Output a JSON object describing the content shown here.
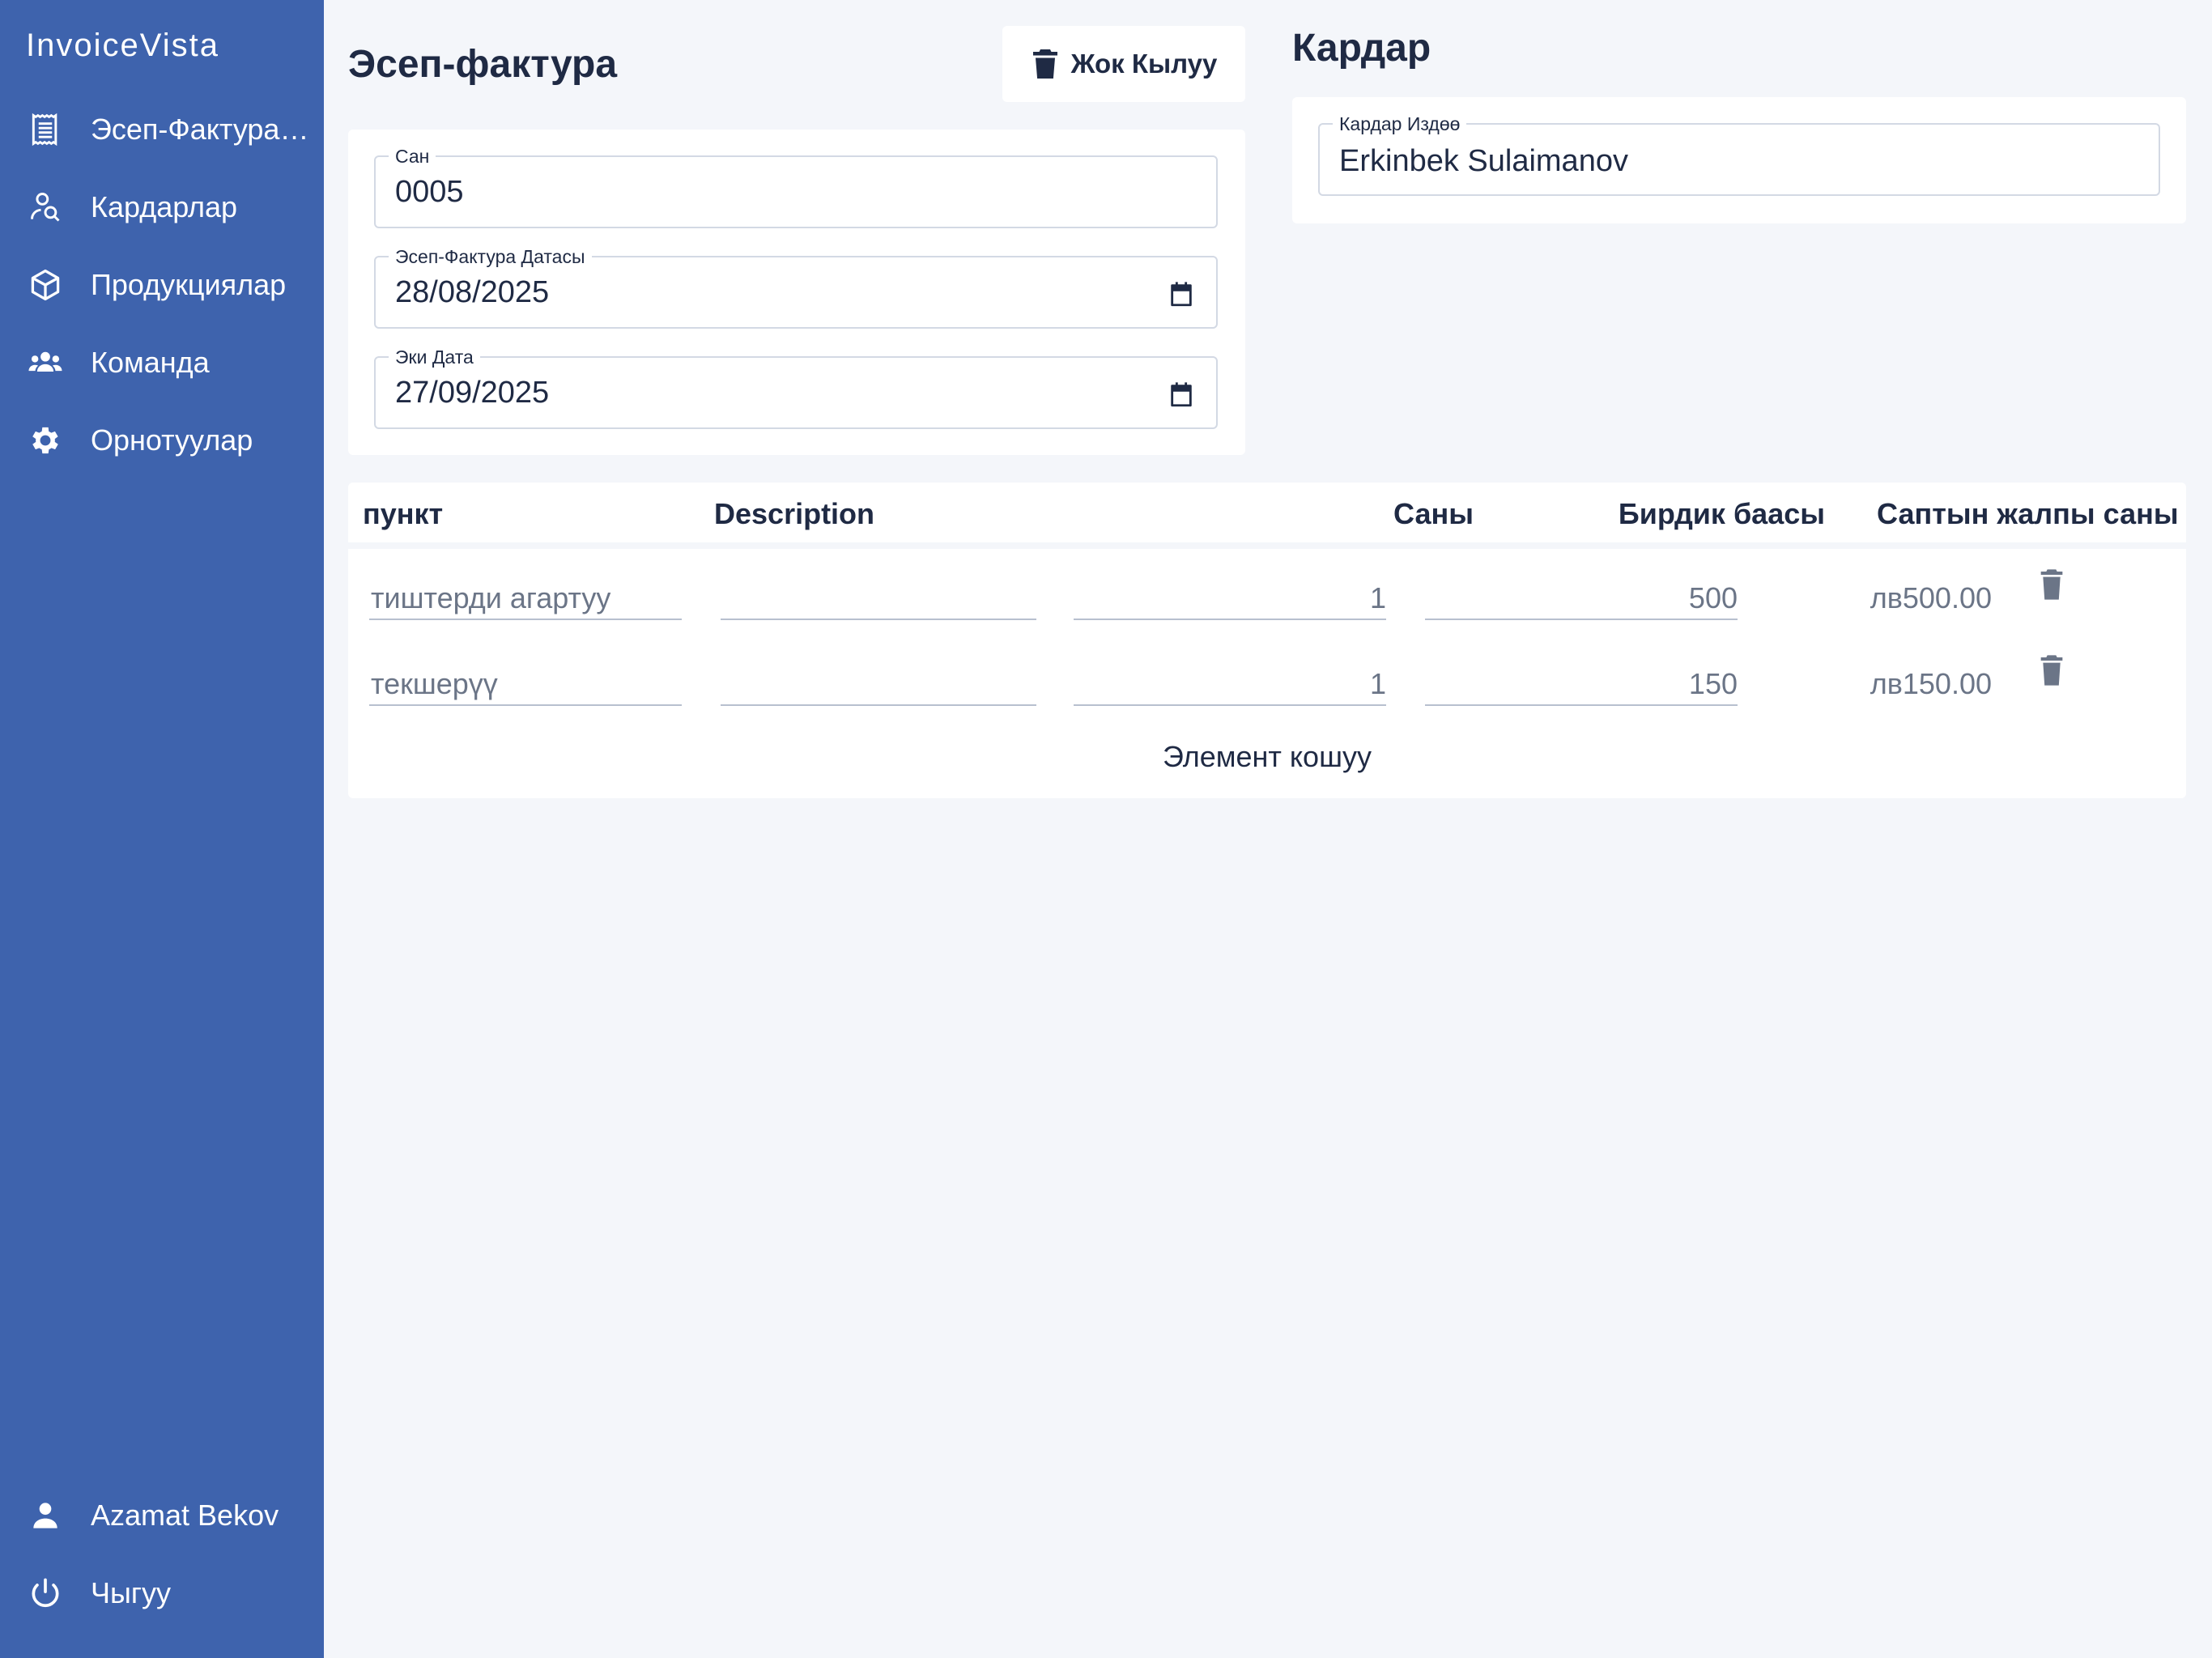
{
  "app": {
    "brand": "InvoiceVista"
  },
  "sidebar": {
    "items": [
      {
        "label": "Эсеп-Фактуралар",
        "icon": "invoice-list-icon"
      },
      {
        "label": "Кардарлар",
        "icon": "user-search-icon"
      },
      {
        "label": "Продукциялар",
        "icon": "box-icon"
      },
      {
        "label": "Команда",
        "icon": "team-icon"
      },
      {
        "label": "Орнотуулар",
        "icon": "gear-icon"
      }
    ],
    "user": {
      "label": "Azamat Bekov",
      "icon": "person-icon"
    },
    "logout": {
      "label": "Чыгуу",
      "icon": "power-icon"
    }
  },
  "invoice": {
    "title": "Эсеп-фактура",
    "delete_label": "Жок Кылуу",
    "number": {
      "label": "Сан",
      "value": "0005"
    },
    "invoice_date": {
      "label": "Эсеп-Фактура Датасы",
      "value": "28/08/2025"
    },
    "due_date": {
      "label": "Эки Дата",
      "value": "27/09/2025"
    }
  },
  "customer": {
    "title": "Кардар",
    "search": {
      "label": "Кардар Издөө",
      "value": "Erkinbek Sulaimanov"
    }
  },
  "items_table": {
    "headers": {
      "item": "пункт",
      "description": "Description",
      "quantity": "Саны",
      "unit_price": "Бирдик баасы",
      "line_total": "Саптын жалпы саны"
    },
    "rows": [
      {
        "item": "тиштерди агартуу",
        "description": "",
        "quantity": "1",
        "unit_price": "500",
        "line_total": "лв500.00"
      },
      {
        "item": "текшерүү",
        "description": "",
        "quantity": "1",
        "unit_price": "150",
        "line_total": "лв150.00"
      }
    ],
    "add_item_label": "Элемент кошуу"
  },
  "colors": {
    "sidebar_bg": "#3e63ad",
    "page_bg": "#f4f6fa",
    "text_dark": "#1f2a44",
    "text_muted": "#6b7587"
  }
}
